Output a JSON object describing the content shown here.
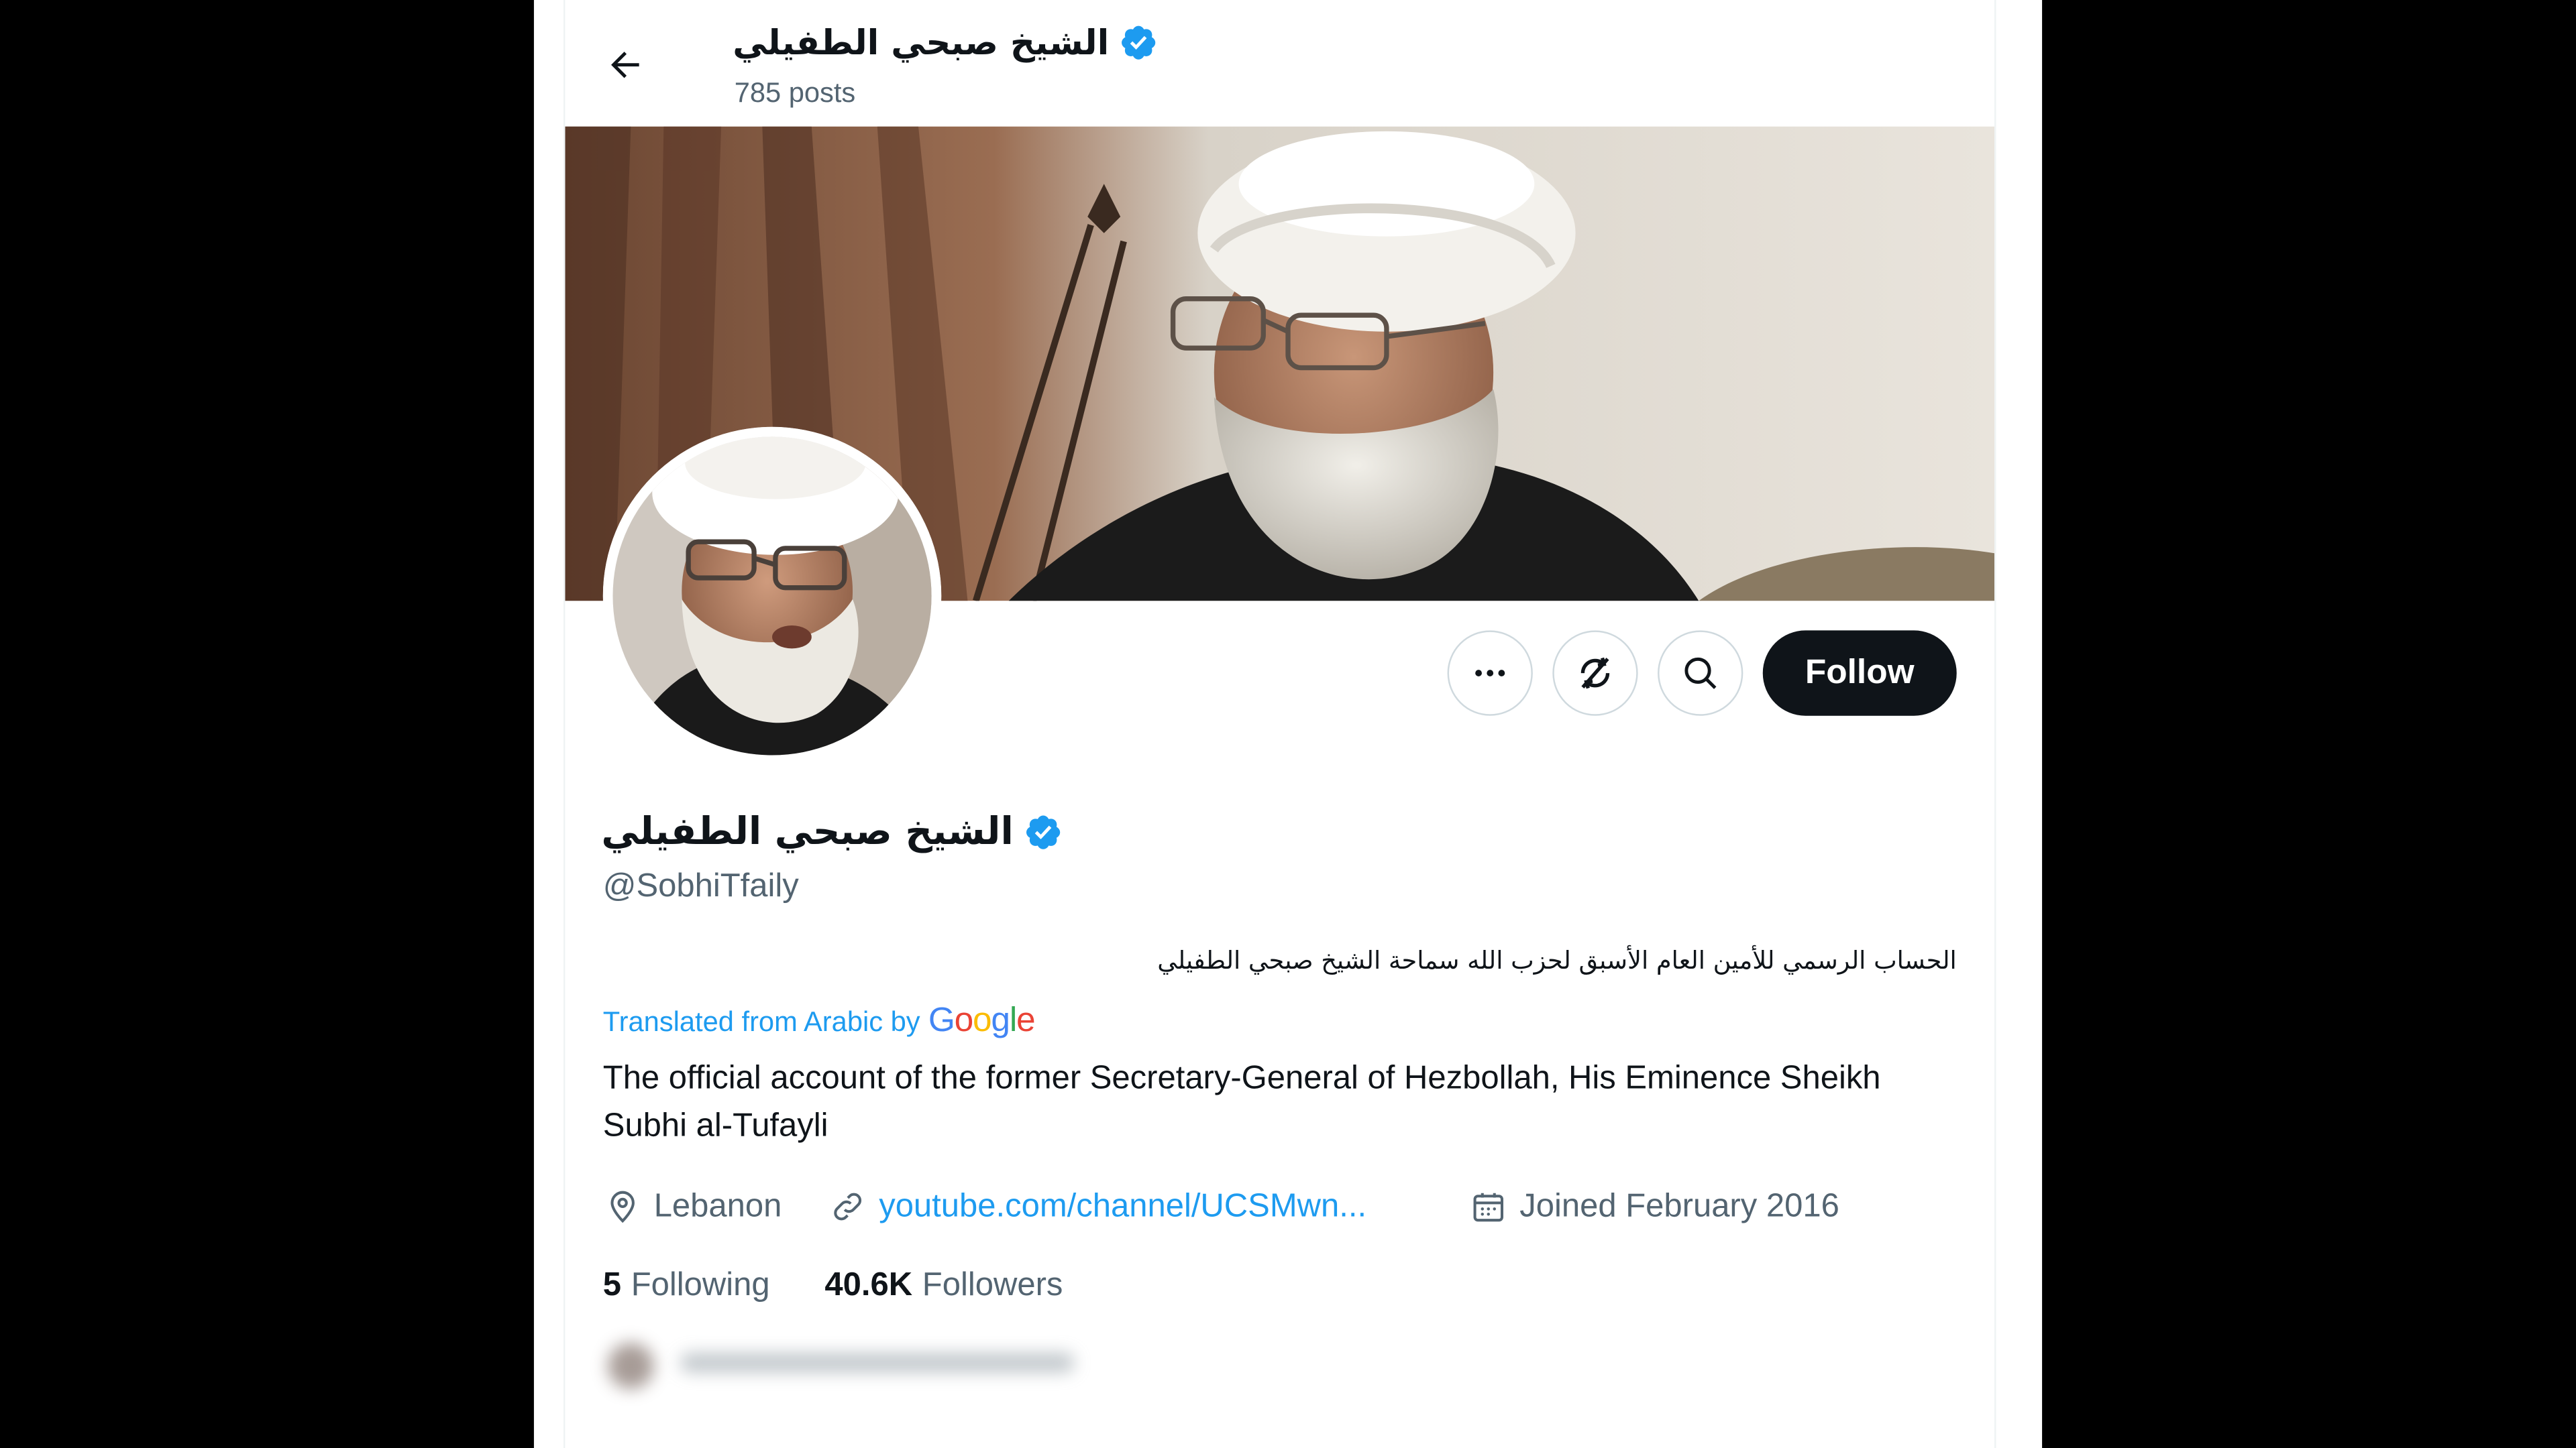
{
  "app": {
    "header": {
      "display_name": "الشيخ صبحي الطفيلي",
      "posts_count": "785 posts"
    },
    "profile": {
      "display_name": "الشيخ صبحي الطفيلي",
      "handle": "@SobhiTfaily",
      "bio_original": "الحساب الرسمي للأمين العام الأسبق لحزب الله سماحة الشيخ صبحي الطفيلي",
      "translated_label": "Translated from Arabic by",
      "google_letters": [
        "G",
        "o",
        "o",
        "g",
        "l",
        "e"
      ],
      "bio_translated": "The official account of the former Secretary-General of Hezbollah, His Eminence Sheikh Subhi al-Tufayli",
      "location": "Lebanon",
      "website": "youtube.com/channel/UCSMwn...",
      "joined": "Joined February 2016",
      "following_count": "5",
      "following_label": "Following",
      "followers_count": "40.6K",
      "followers_label": "Followers"
    },
    "actions": {
      "follow_label": "Follow",
      "more_icon": "more-horizontal-icon",
      "notifications_icon": "subscribe-off-icon",
      "search_icon": "search-icon"
    },
    "colors": {
      "accent": "#1d9bf0",
      "text_primary": "#0f1419",
      "text_secondary": "#536471",
      "google_blue": "#4285f4",
      "google_red": "#ea4335",
      "google_yellow": "#fbbc05",
      "google_green": "#34a853"
    }
  }
}
